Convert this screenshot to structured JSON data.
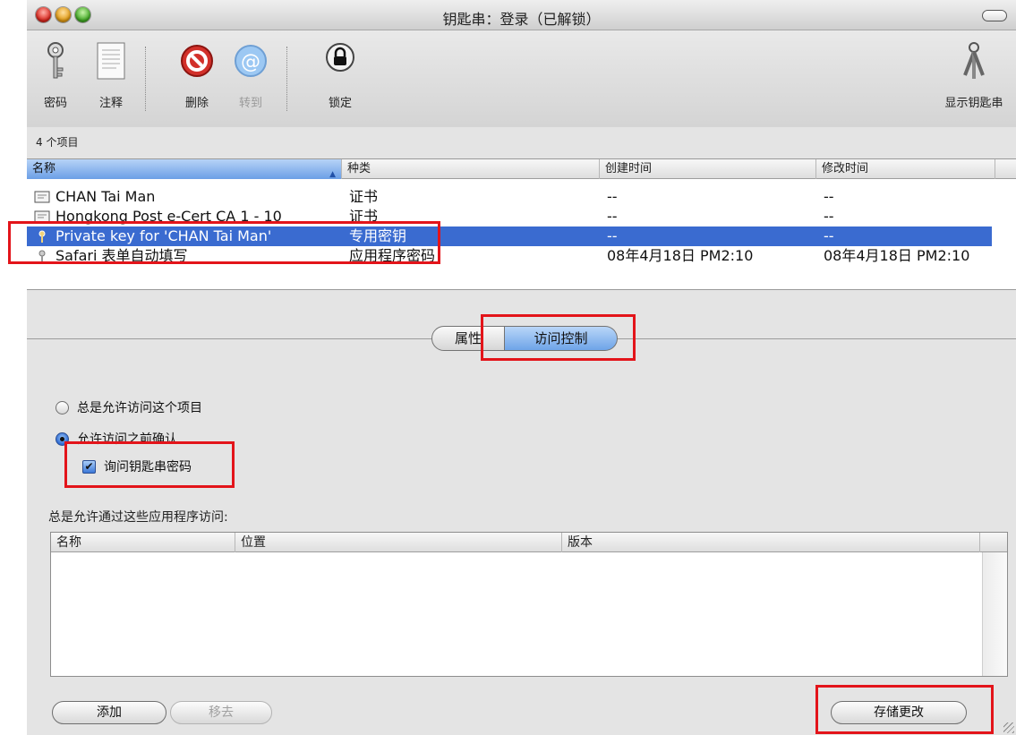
{
  "window": {
    "title": "钥匙串：登录（已解锁）"
  },
  "toolbar": {
    "password_label": "密码",
    "note_label": "注释",
    "delete_label": "删除",
    "goto_label": "转到",
    "lock_label": "锁定",
    "show_keychains_label": "显示钥匙串"
  },
  "items_count": "4 个项目",
  "items_table": {
    "columns": [
      "名称",
      "种类",
      "创建时间",
      "修改时间"
    ],
    "rows": [
      {
        "name": "CHAN Tai Man",
        "kind": "证书",
        "created": "--",
        "modified": "--",
        "icon": "certificate-icon"
      },
      {
        "name": "Hongkong Post e-Cert CA 1 - 10",
        "kind": "证书",
        "created": "--",
        "modified": "--",
        "icon": "certificate-icon"
      },
      {
        "name": "Private key for 'CHAN Tai Man'",
        "kind": "专用密钥",
        "created": "--",
        "modified": "--",
        "icon": "key-icon",
        "selected": true
      },
      {
        "name": "Safari 表单自动填写",
        "kind": "应用程序密码",
        "created": "08年4月18日 PM2:10",
        "modified": "08年4月18日 PM2:10",
        "icon": "key-icon"
      }
    ]
  },
  "tabs": {
    "attributes": "属性",
    "access_control": "访问控制"
  },
  "access": {
    "always_allow": "总是允许访问这个项目",
    "confirm_before": "允许访问之前确认",
    "ask_password": "询问钥匙串密码",
    "apps_label": "总是允许通过这些应用程序访问:",
    "apps_columns": [
      "名称",
      "位置",
      "版本"
    ]
  },
  "buttons": {
    "add": "添加",
    "remove": "移去",
    "save": "存储更改"
  },
  "colors": {
    "selection": "#3a6bd0",
    "highlight": "#e3141a",
    "window_bg": "#e4e4e4"
  }
}
